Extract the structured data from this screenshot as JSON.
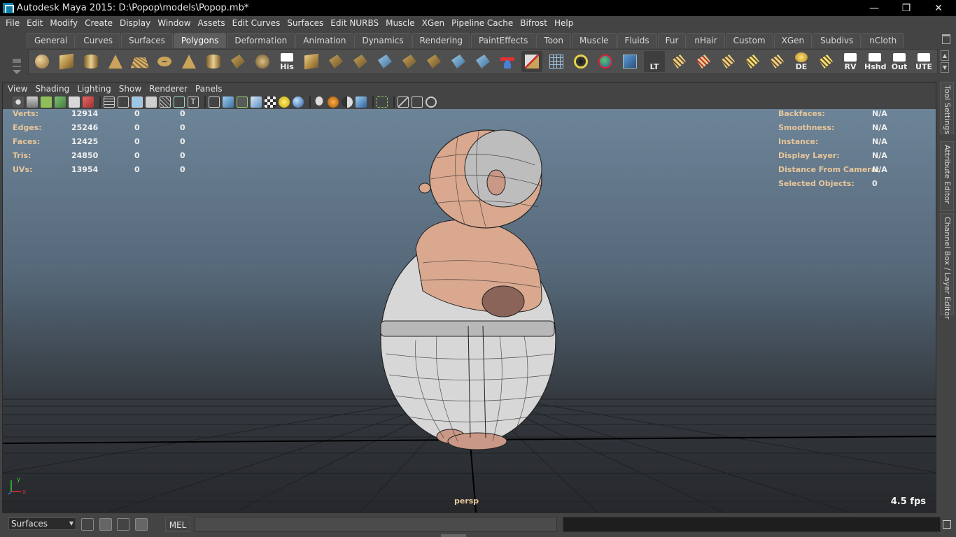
{
  "window": {
    "title": "Autodesk Maya 2015: D:\\Popop\\models\\Popop.mb*",
    "minimize": "—",
    "restore": "❐",
    "close": "✕"
  },
  "menubar": [
    "File",
    "Edit",
    "Modify",
    "Create",
    "Display",
    "Window",
    "Assets",
    "Edit Curves",
    "Surfaces",
    "Edit NURBS",
    "Muscle",
    "XGen",
    "Pipeline Cache",
    "Bifrost",
    "Help"
  ],
  "shelf": {
    "tabs": [
      "General",
      "Curves",
      "Surfaces",
      "Polygons",
      "Deformation",
      "Animation",
      "Dynamics",
      "Rendering",
      "PaintEffects",
      "Toon",
      "Muscle",
      "Fluids",
      "Fur",
      "nHair",
      "Custom",
      "XGen",
      "Subdivs",
      "nCloth"
    ],
    "active_tab": "Polygons",
    "text_icons": {
      "his": "His",
      "lt": "LT",
      "de": "DE",
      "rv": "RV",
      "hshd": "Hshd",
      "out": "Out",
      "ute": "UTE"
    }
  },
  "panel": {
    "menu": [
      "View",
      "Shading",
      "Lighting",
      "Show",
      "Renderer",
      "Panels"
    ],
    "camera": "persp",
    "fps": "4.5 fps",
    "axis_y": "y",
    "axis_x": "x"
  },
  "hud_left": [
    {
      "label": "Verts:",
      "v1": "12914",
      "v2": "0",
      "v3": "0"
    },
    {
      "label": "Edges:",
      "v1": "25246",
      "v2": "0",
      "v3": "0"
    },
    {
      "label": "Faces:",
      "v1": "12425",
      "v2": "0",
      "v3": "0"
    },
    {
      "label": "Tris:",
      "v1": "24850",
      "v2": "0",
      "v3": "0"
    },
    {
      "label": "UVs:",
      "v1": "13954",
      "v2": "0",
      "v3": "0"
    }
  ],
  "hud_right": [
    {
      "label": "Backfaces:",
      "value": "N/A"
    },
    {
      "label": "Smoothness:",
      "value": "N/A"
    },
    {
      "label": "Instance:",
      "value": "N/A"
    },
    {
      "label": "Display Layer:",
      "value": "N/A"
    },
    {
      "label": "Distance From Camera:",
      "value": "N/A"
    },
    {
      "label": "Selected Objects:",
      "value": "0"
    }
  ],
  "side_tabs": [
    "Tool Settings",
    "Attribute Editor",
    "Channel Box / Layer Editor"
  ],
  "commandline": {
    "mode": "Surfaces",
    "language": "MEL"
  },
  "colors": {
    "hud_label": "#e8c69a",
    "skin": "#d9a88f",
    "viewport_top": "#6d8498",
    "viewport_bottom": "#26282b"
  }
}
